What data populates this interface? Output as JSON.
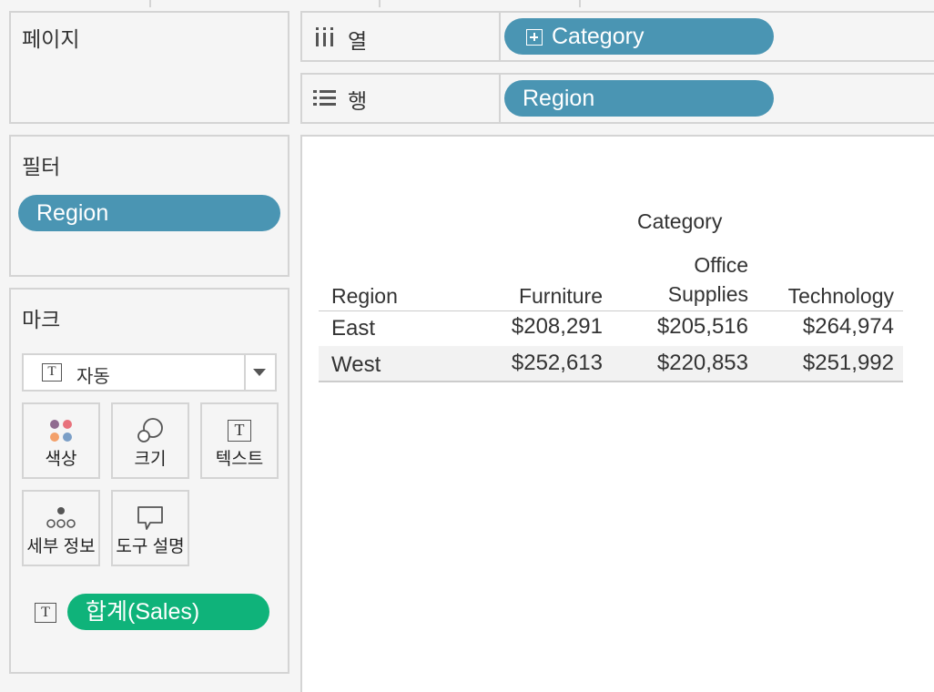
{
  "pages_panel": {
    "title": "페이지"
  },
  "filters_panel": {
    "title": "필터",
    "pills": [
      {
        "label": "Region"
      }
    ]
  },
  "marks_panel": {
    "title": "마크",
    "mark_type": "자동",
    "buttons": [
      {
        "label": "색상",
        "icon": "color-icon"
      },
      {
        "label": "크기",
        "icon": "size-icon"
      },
      {
        "label": "텍스트",
        "icon": "text-icon"
      },
      {
        "label": "세부 정보",
        "icon": "detail-icon"
      },
      {
        "label": "도구 설명",
        "icon": "tooltip-icon"
      }
    ],
    "field_pill": {
      "label": "합계(Sales)",
      "color": "#0fb37a"
    }
  },
  "columns_shelf": {
    "label": "열",
    "pill": "Category",
    "pill_color": "#4a95b3"
  },
  "rows_shelf": {
    "label": "행",
    "pill": "Region",
    "pill_color": "#4a95b3"
  },
  "crosstab": {
    "column_header_title": "Category",
    "row_header_title": "Region",
    "columns": [
      "Furniture",
      "Office",
      "Supplies",
      "Technology"
    ],
    "rows": [
      {
        "label": "East",
        "values": [
          "$208,291",
          "$205,516",
          "$264,974"
        ]
      },
      {
        "label": "West",
        "values": [
          "$252,613",
          "$220,853",
          "$251,992"
        ]
      }
    ]
  }
}
